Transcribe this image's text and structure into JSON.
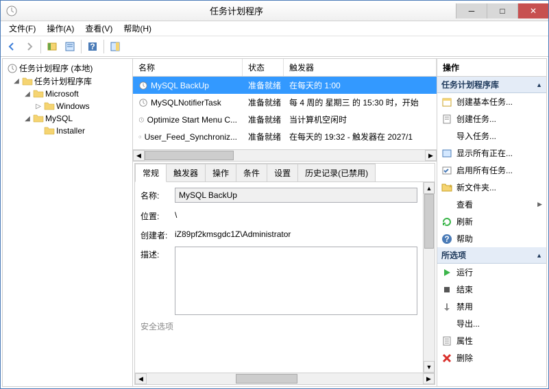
{
  "window": {
    "title": "任务计划程序"
  },
  "menu": {
    "file": "文件(F)",
    "action": "操作(A)",
    "view": "查看(V)",
    "help": "帮助(H)"
  },
  "tree": {
    "root": "任务计划程序 (本地)",
    "library": "任务计划程序库",
    "microsoft": "Microsoft",
    "windows": "Windows",
    "mysql": "MySQL",
    "installer": "Installer"
  },
  "list": {
    "headers": {
      "name": "名称",
      "status": "状态",
      "trigger": "触发器"
    },
    "rows": [
      {
        "name": "MySQL BackUp",
        "status": "准备就绪",
        "trigger": "在每天的 1:00"
      },
      {
        "name": "MySQLNotifierTask",
        "status": "准备就绪",
        "trigger": "每 4 周的 星期三 的 15:30 时，开始"
      },
      {
        "name": "Optimize Start Menu C...",
        "status": "准备就绪",
        "trigger": "当计算机空闲时"
      },
      {
        "name": "User_Feed_Synchroniz...",
        "status": "准备就绪",
        "trigger": "在每天的 19:32 - 触发器在 2027/1"
      }
    ]
  },
  "tabs": {
    "general": "常规",
    "triggers": "触发器",
    "actions": "操作",
    "conditions": "条件",
    "settings": "设置",
    "history": "历史记录(已禁用)"
  },
  "detail": {
    "name_label": "名称:",
    "name_value": "MySQL BackUp",
    "location_label": "位置:",
    "location_value": "\\",
    "author_label": "创建者:",
    "author_value": "iZ89pf2kmsgdc1Z\\Administrator",
    "desc_label": "描述:",
    "desc_value": "",
    "security_label": "安全选项"
  },
  "actions": {
    "header": "操作",
    "section1": "任务计划程序库",
    "items1": [
      {
        "icon": "calendar",
        "label": "创建基本任务..."
      },
      {
        "icon": "task",
        "label": "创建任务..."
      },
      {
        "icon": "",
        "label": "导入任务..."
      },
      {
        "icon": "running",
        "label": "显示所有正在..."
      },
      {
        "icon": "enable",
        "label": "启用所有任务..."
      },
      {
        "icon": "newfolder",
        "label": "新文件夹..."
      },
      {
        "icon": "",
        "label": "查看",
        "submenu": true
      },
      {
        "icon": "refresh",
        "label": "刷新"
      },
      {
        "icon": "help",
        "label": "帮助"
      }
    ],
    "section2": "所选项",
    "items2": [
      {
        "icon": "run",
        "label": "运行"
      },
      {
        "icon": "end",
        "label": "结束"
      },
      {
        "icon": "disable",
        "label": "禁用"
      },
      {
        "icon": "",
        "label": "导出..."
      },
      {
        "icon": "properties",
        "label": "属性"
      },
      {
        "icon": "delete",
        "label": "删除"
      }
    ]
  }
}
